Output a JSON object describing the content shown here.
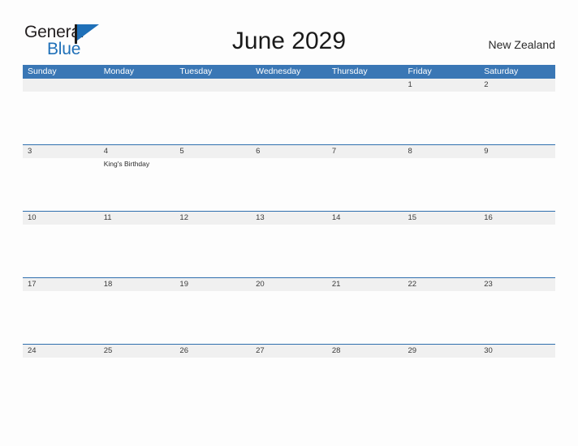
{
  "brand": {
    "name_part1": "General",
    "name_part2": "Blue",
    "flag_icon": "flag-triangle-icon",
    "color_primary": "#1f70b8",
    "color_text": "#231f20"
  },
  "header": {
    "title": "June 2029",
    "region": "New Zealand"
  },
  "calendar": {
    "accent_color": "#3a77b5",
    "row_border_color": "#2f6fae",
    "date_band_color": "#f0f0f0",
    "weekdays": [
      "Sunday",
      "Monday",
      "Tuesday",
      "Wednesday",
      "Thursday",
      "Friday",
      "Saturday"
    ],
    "weeks": [
      [
        {
          "date": "",
          "event": ""
        },
        {
          "date": "",
          "event": ""
        },
        {
          "date": "",
          "event": ""
        },
        {
          "date": "",
          "event": ""
        },
        {
          "date": "",
          "event": ""
        },
        {
          "date": "1",
          "event": ""
        },
        {
          "date": "2",
          "event": ""
        }
      ],
      [
        {
          "date": "3",
          "event": ""
        },
        {
          "date": "4",
          "event": "King's Birthday"
        },
        {
          "date": "5",
          "event": ""
        },
        {
          "date": "6",
          "event": ""
        },
        {
          "date": "7",
          "event": ""
        },
        {
          "date": "8",
          "event": ""
        },
        {
          "date": "9",
          "event": ""
        }
      ],
      [
        {
          "date": "10",
          "event": ""
        },
        {
          "date": "11",
          "event": ""
        },
        {
          "date": "12",
          "event": ""
        },
        {
          "date": "13",
          "event": ""
        },
        {
          "date": "14",
          "event": ""
        },
        {
          "date": "15",
          "event": ""
        },
        {
          "date": "16",
          "event": ""
        }
      ],
      [
        {
          "date": "17",
          "event": ""
        },
        {
          "date": "18",
          "event": ""
        },
        {
          "date": "19",
          "event": ""
        },
        {
          "date": "20",
          "event": ""
        },
        {
          "date": "21",
          "event": ""
        },
        {
          "date": "22",
          "event": ""
        },
        {
          "date": "23",
          "event": ""
        }
      ],
      [
        {
          "date": "24",
          "event": ""
        },
        {
          "date": "25",
          "event": ""
        },
        {
          "date": "26",
          "event": ""
        },
        {
          "date": "27",
          "event": ""
        },
        {
          "date": "28",
          "event": ""
        },
        {
          "date": "29",
          "event": ""
        },
        {
          "date": "30",
          "event": ""
        }
      ]
    ]
  }
}
